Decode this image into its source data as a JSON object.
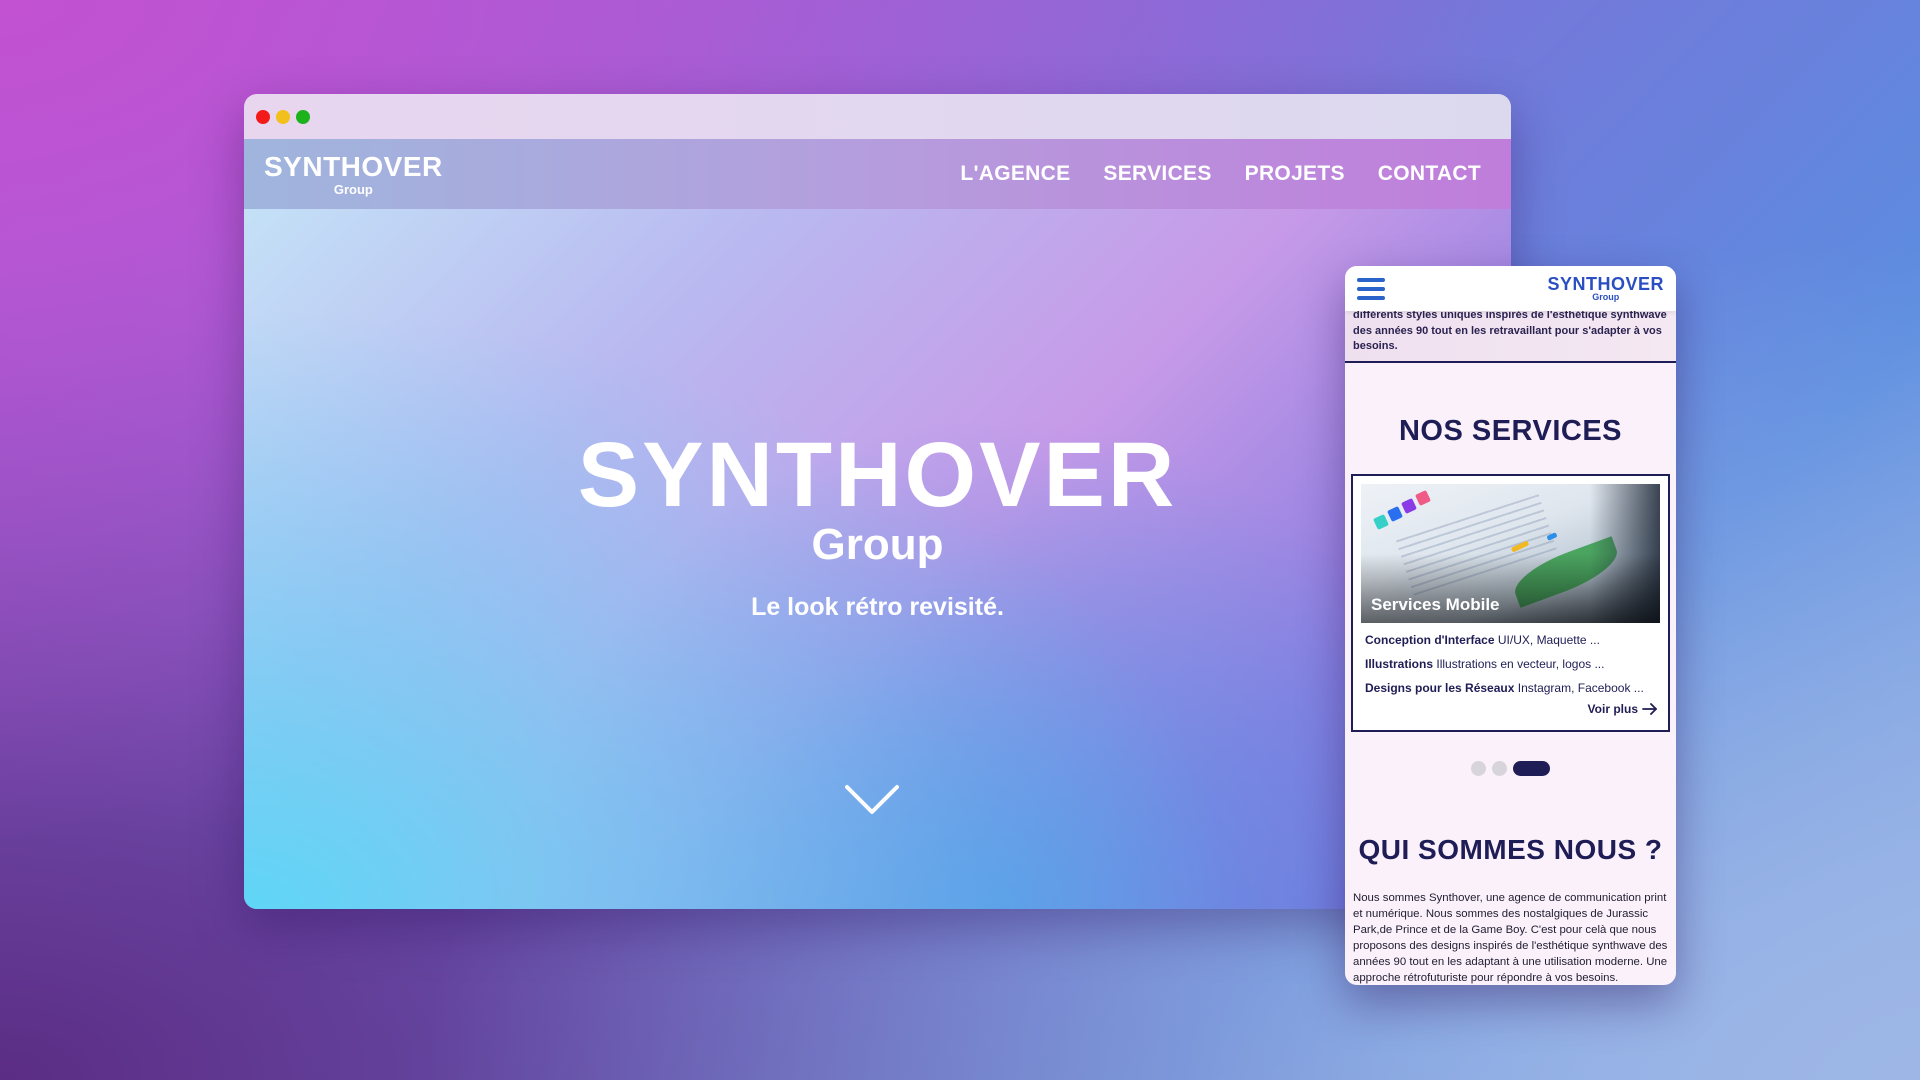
{
  "colors": {
    "navy": "#1f1d55",
    "mobile_logo_blue": "#2b4fc2",
    "hamburger_blue": "#2a63c9"
  },
  "desktop": {
    "logo": {
      "word": "SYNTHOVER",
      "sub": "Group"
    },
    "nav": [
      {
        "label": "L'AGENCE"
      },
      {
        "label": "SERVICES"
      },
      {
        "label": "PROJETS"
      },
      {
        "label": "CONTACT"
      }
    ],
    "hero": {
      "logo_word": "SYNTHOVER",
      "logo_sub": "Group",
      "tagline": "Le look rétro revisité.",
      "scroll_icon": "chevron-down-icon"
    }
  },
  "mobile": {
    "menu_icon": "hamburger-menu-icon",
    "logo": {
      "word": "SYNTHOVER",
      "sub": "Group"
    },
    "intro_text": "différents styles uniques inspirés de l'esthétique synthwave des années 90 tout en les retravaillant pour s'adapter à vos besoins.",
    "services_title": "NOS SERVICES",
    "card": {
      "title": "Services Mobile",
      "items": [
        {
          "label": "Conception d'Interface",
          "detail": "UI/UX, Maquette ..."
        },
        {
          "label": "Illustrations",
          "detail": "Illustrations en vecteur, logos ..."
        },
        {
          "label": "Designs pour les Réseaux",
          "detail": "Instagram, Facebook ..."
        }
      ],
      "more_label": "Voir plus",
      "more_icon": "arrow-right-icon"
    },
    "pager": {
      "count": 3,
      "active_index": 2
    },
    "about_title": "QUI SOMMES NOUS ?",
    "about_text": "Nous sommes Synthover, une agence de communication print et numérique. Nous sommes des nostalgiques de Jurassic Park,de Prince et de la Game Boy. C'est pour celà que nous proposons des designs inspirés de l'esthétique synthwave des années 90 tout en les adaptant à une utilisation moderne. Une approche rétrofuturiste pour répondre à vos besoins."
  }
}
